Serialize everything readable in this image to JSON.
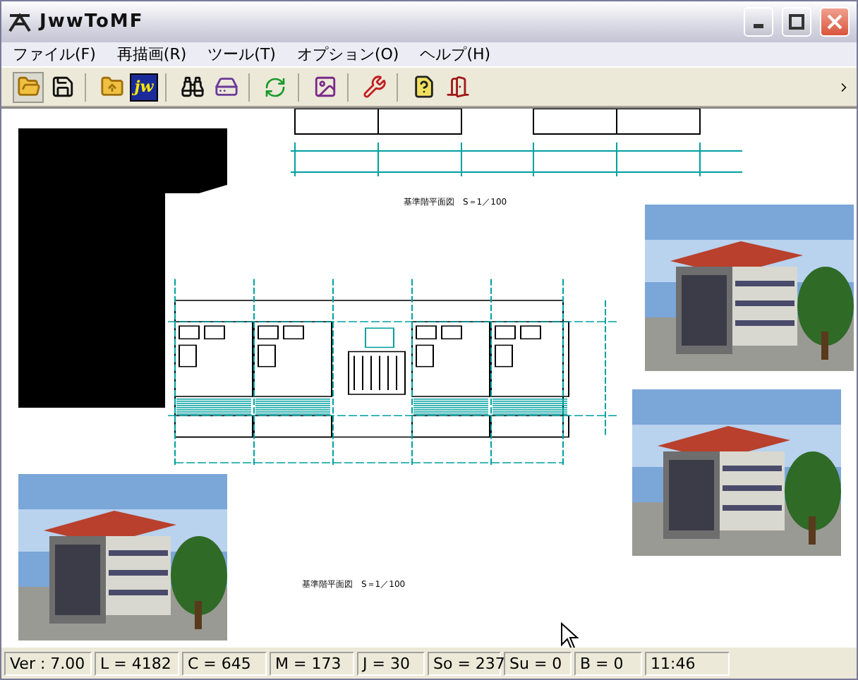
{
  "window": {
    "title": "JwwToMF"
  },
  "menu": [
    "ファイル(F)",
    "再描画(R)",
    "ツール(T)",
    "オプション(O)",
    "ヘルプ(H)"
  ],
  "toolbar": {
    "jw_label": "jw"
  },
  "drawing": {
    "captions": [
      "基準階平面図　S＝1／100",
      "基準階平面図　S＝1／100"
    ]
  },
  "status_bar": [
    "Ver : 7.00",
    "L = 4182",
    "C = 645",
    "M = 173",
    "J = 30",
    "So = 237",
    "Su = 0",
    "B = 0",
    "11:46"
  ]
}
